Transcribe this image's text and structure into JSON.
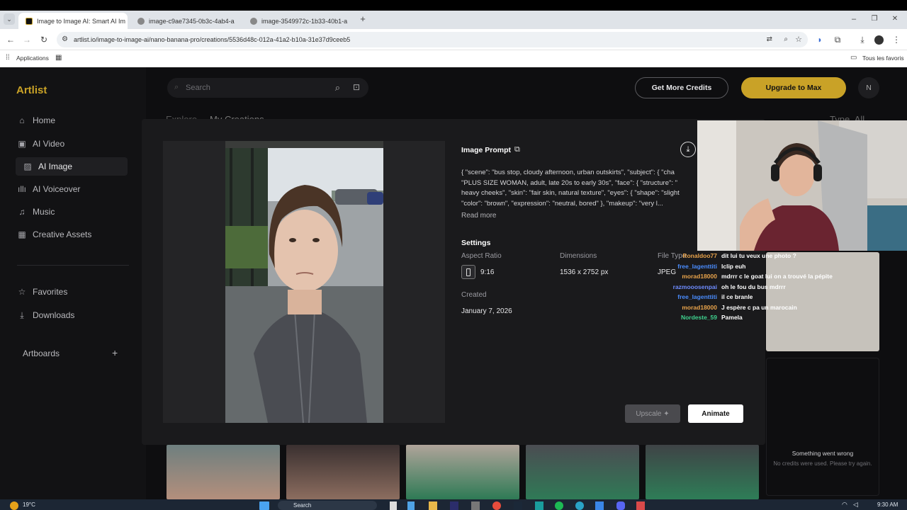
{
  "browser": {
    "tabs": [
      {
        "title": "Image to Image AI: Smart AI Im",
        "active": true
      },
      {
        "title": "image-c9ae7345-0b3c-4ab4-a",
        "active": false
      },
      {
        "title": "image-3549972c-1b33-40b1-a",
        "active": false
      }
    ],
    "url": "artlist.io/image-to-image-ai/nano-banana-pro/creations/5536d48c-012a-41a2-b10a-31e37d9ceeb5",
    "bookmarks_left": "Applications",
    "bookmarks_right": "Tous les favoris"
  },
  "app": {
    "logo": "Artlist",
    "search_placeholder": "Search",
    "get_credits": "Get More Credits",
    "upgrade": "Upgrade to Max",
    "avatar": "N",
    "nav": [
      {
        "label": "Home",
        "icon": "home-icon"
      },
      {
        "label": "AI Video",
        "icon": "video-icon"
      },
      {
        "label": "AI Image",
        "icon": "image-icon"
      },
      {
        "label": "AI Voiceover",
        "icon": "waveform-icon"
      },
      {
        "label": "Music",
        "icon": "music-icon"
      },
      {
        "label": "Creative Assets",
        "icon": "grid-icon"
      },
      {
        "label": "Favorites",
        "icon": "star-icon"
      },
      {
        "label": "Downloads",
        "icon": "download-icon"
      }
    ],
    "artboards": "Artboards",
    "tabs": {
      "explore": "Explore",
      "my_creations": "My Creations"
    },
    "type_filter": "Type  All",
    "error_title": "Something went wrong",
    "error_text": "No credits were used. Please try again."
  },
  "modal": {
    "prompt_title": "Image Prompt",
    "prompt_lines": [
      "{ \"scene\": \"bus stop, cloudy afternoon, urban outskirts\", \"subject\": { \"cha",
      "\"PLUS SIZE WOMAN, adult, late 20s to early 30s\", \"face\": { \"structure\": \"",
      "heavy cheeks\", \"skin\": \"fair skin, natural texture\", \"eyes\": { \"shape\": \"slight",
      "\"color\": \"brown\", \"expression\": \"neutral, bored\" }, \"makeup\": \"very l..."
    ],
    "read_more": "Read more",
    "settings_title": "Settings",
    "aspect_label": "Aspect Ratio",
    "aspect_value": "9:16",
    "dimensions_label": "Dimensions",
    "dimensions_value": "1536 x 2752 px",
    "filetype_label": "File Type",
    "filetype_value": "JPEG",
    "created_label": "Created",
    "created_value": "January 7, 2026",
    "upscale": "Upscale ✦",
    "animate": "Animate"
  },
  "chat": [
    {
      "user": "Ronaldoo77",
      "msg": "dit lui tu veux une photo ?",
      "color": "#e8a34b"
    },
    {
      "user": "free_lagenttiti",
      "msg": "lclip euh",
      "color": "#4a8dff"
    },
    {
      "user": "morad18000",
      "msg": "mdrrr c le goat lui on a trouvé la pépite",
      "color": "#e8a34b"
    },
    {
      "user": "razmooosenpai",
      "msg": "oh le fou du bus mdrrr",
      "color": "#6e8cff"
    },
    {
      "user": "free_lagenttiti",
      "msg": "il ce branle",
      "color": "#4a8dff"
    },
    {
      "user": "morad18000",
      "msg": "J espère c pa un marocain",
      "color": "#e8a34b"
    },
    {
      "user": "Nordeste_59",
      "msg": "Pamela",
      "color": "#3fd28f"
    }
  ],
  "taskbar": {
    "weather": "19°C",
    "search": "Search",
    "time": "9:30 AM"
  },
  "colors": {
    "upgrade_bg": "#c9a227",
    "app_bg": "#0e0e10",
    "modal_bg": "#1a1a1c"
  }
}
